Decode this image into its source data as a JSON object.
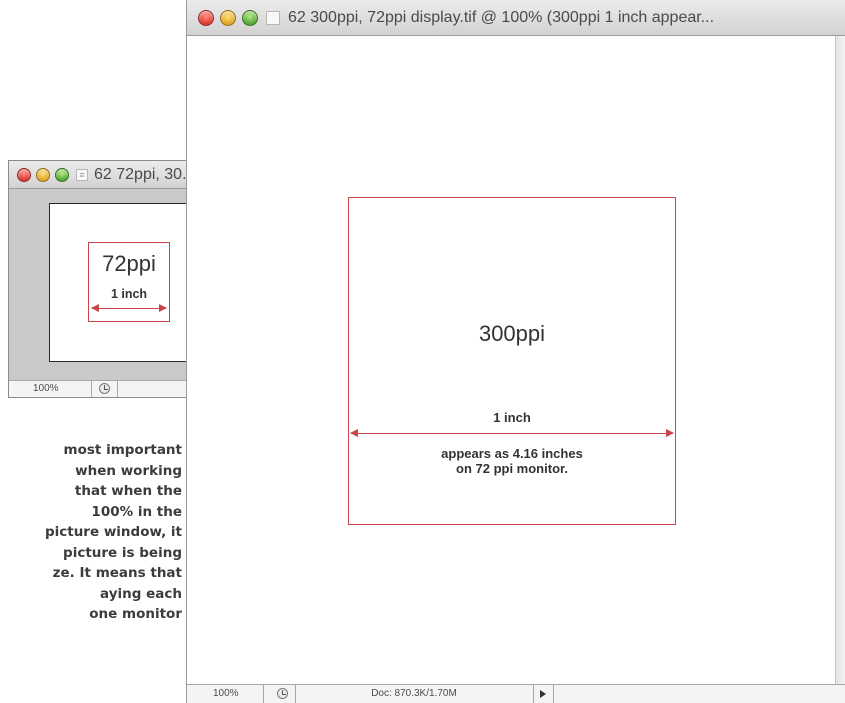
{
  "body_copy": {
    "lines": [
      "most important",
      "when working",
      "that when the",
      "100% in the",
      "picture window, it",
      "picture is being",
      "ze. It means that",
      "aying each",
      "one monitor"
    ]
  },
  "small_window": {
    "title": "62 72ppi, 30...",
    "canvas_label": "72ppi",
    "measure_label": "1 inch",
    "zoom": "100%"
  },
  "big_window": {
    "title": "62 300ppi, 72ppi display.tif @ 100% (300ppi   1 inch appear...",
    "canvas_label": "300ppi",
    "measure_label": "1 inch",
    "note_line1": "appears as 4.16 inches",
    "note_line2": "on 72 ppi monitor.",
    "zoom": "100%",
    "doc_size": "Doc: 870.3K/1.70M"
  },
  "colors": {
    "annotation_red": "#c8454a",
    "window_gray": "#c8c9cb"
  },
  "icons": [
    "close-icon",
    "minimize-icon",
    "zoom-icon",
    "document-proxy-icon",
    "clock-icon",
    "play-arrow-icon"
  ]
}
